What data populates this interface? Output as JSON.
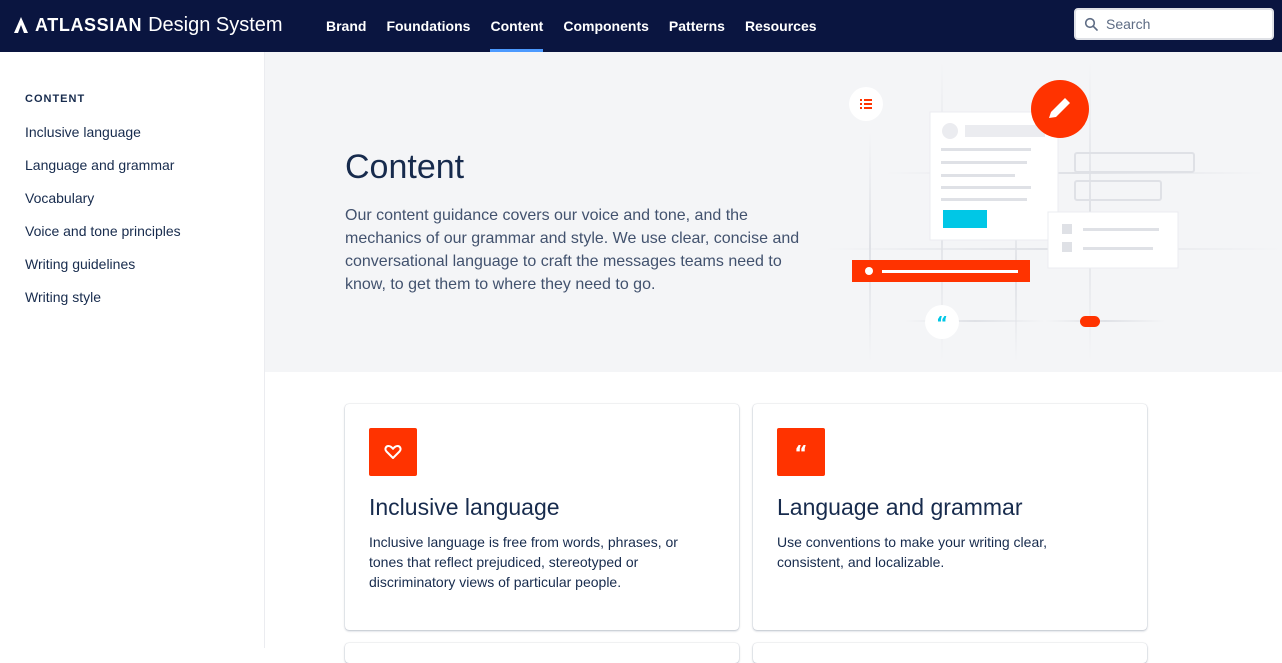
{
  "brand": {
    "name": "ATLASSIAN",
    "subtitle": "Design System"
  },
  "nav": {
    "items": [
      {
        "label": "Brand"
      },
      {
        "label": "Foundations"
      },
      {
        "label": "Content"
      },
      {
        "label": "Components"
      },
      {
        "label": "Patterns"
      },
      {
        "label": "Resources"
      }
    ],
    "active": "Content"
  },
  "search": {
    "placeholder": "Search",
    "value": ""
  },
  "sidebar": {
    "heading": "CONTENT",
    "items": [
      {
        "label": "Inclusive language"
      },
      {
        "label": "Language and grammar"
      },
      {
        "label": "Vocabulary"
      },
      {
        "label": "Voice and tone principles"
      },
      {
        "label": "Writing guidelines"
      },
      {
        "label": "Writing style"
      }
    ]
  },
  "hero": {
    "title": "Content",
    "description": "Our content guidance covers our voice and tone, and the mechanics of our grammar and style. We use clear, concise and conversational language to craft the messages teams need to know, to get them to where they need to go."
  },
  "cards": [
    {
      "icon": "heart-icon",
      "title": "Inclusive language",
      "description": "Inclusive language is free from words, phrases, or tones that reflect prejudiced, stereotyped or discriminatory views of particular people."
    },
    {
      "icon": "quote-icon",
      "title": "Language and grammar",
      "description": "Use conventions to make your writing clear, consistent, and localizable."
    }
  ],
  "colors": {
    "nav_bg": "#0a1540",
    "accent": "#ff3300",
    "active_underline": "#4c9aff",
    "teal": "#00c7e6",
    "hero_bg": "#f4f5f7"
  }
}
